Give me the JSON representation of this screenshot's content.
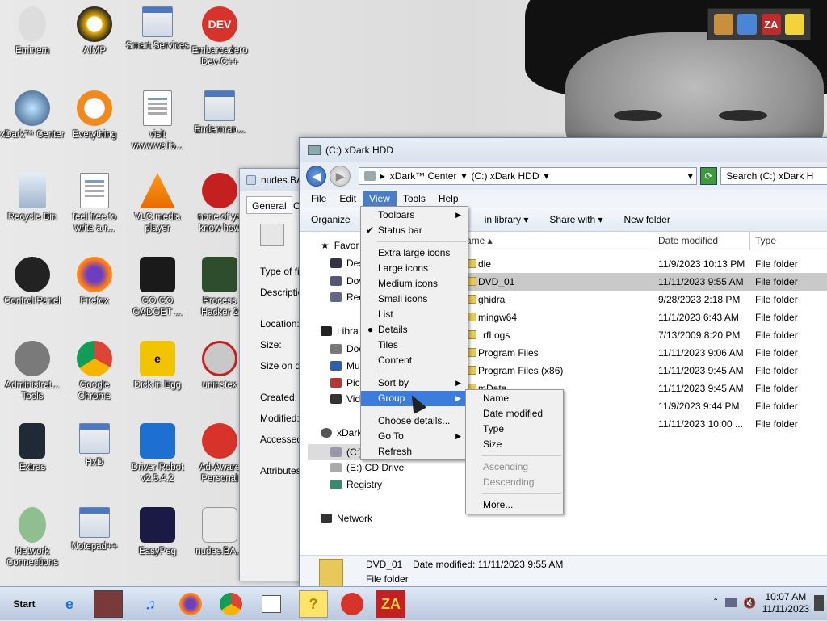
{
  "desktop": {
    "icons": [
      {
        "label": "Eminem"
      },
      {
        "label": "AIMP"
      },
      {
        "label": "Smart Services"
      },
      {
        "label": "Embarcadero Dev-C++"
      },
      {
        "label": "xDark™ Center"
      },
      {
        "label": "Everything"
      },
      {
        "label": "visit www.walib..."
      },
      {
        "label": "Enderman..."
      },
      {
        "label": "Recycle Bin"
      },
      {
        "label": "feel free to write a r..."
      },
      {
        "label": "VLC media player"
      },
      {
        "label": "none of yo know how"
      },
      {
        "label": "Control Panel"
      },
      {
        "label": "Firefox"
      },
      {
        "label": "GO GO GADGET ..."
      },
      {
        "label": "Process Hacker 2"
      },
      {
        "label": "Administrat... Tools"
      },
      {
        "label": "Google Chrome"
      },
      {
        "label": "Dick in Egg"
      },
      {
        "label": "uninstex"
      },
      {
        "label": "Extras"
      },
      {
        "label": "HxD"
      },
      {
        "label": "Driver Robot v2.5.4.2"
      },
      {
        "label": "Ad-Aware Personal"
      },
      {
        "label": "Network Connections"
      },
      {
        "label": "Notepad++"
      },
      {
        "label": "EasyPeg"
      },
      {
        "label": "nudes.BA..."
      }
    ],
    "toolbar_badge": "ZA"
  },
  "properties": {
    "title": "nudes.BA",
    "tab_general": "General",
    "tab_other": "C",
    "labels": [
      "Type of fil",
      "Descriptio",
      "Location:",
      "Size:",
      "Size on di",
      "Created:",
      "Modified:",
      "Accessed",
      "Attributes:"
    ]
  },
  "explorer": {
    "title": "(C:) xDark HDD",
    "breadcrumb": [
      "xDark™ Center",
      "(C:) xDark HDD"
    ],
    "search_placeholder": "Search (C:) xDark H",
    "menu": [
      "File",
      "Edit",
      "View",
      "Tools",
      "Help"
    ],
    "commands": {
      "organize": "Organize",
      "include": "in library",
      "share": "Share with",
      "newfolder": "New folder"
    },
    "nav": {
      "favorites": "Favor",
      "desktop": "Des",
      "downloads": "Dov",
      "recent": "Rec",
      "libraries": "Libra",
      "documents": "Doc",
      "music": "Mu",
      "pictures": "Pict",
      "videos": "Vide",
      "computer": "xDark",
      "cdrive": "(C:)",
      "edrive": "(E:) CD Drive",
      "registry": "Registry",
      "network": "Network"
    },
    "columns": {
      "name": "ame",
      "date": "Date modified",
      "type": "Type"
    },
    "files": [
      {
        "name": "die",
        "date": "11/9/2023 10:13 PM",
        "type": "File folder"
      },
      {
        "name": "DVD_01",
        "date": "11/11/2023 9:55 AM",
        "type": "File folder"
      },
      {
        "name": "ghidra",
        "date": "9/28/2023 2:18 PM",
        "type": "File folder"
      },
      {
        "name": "mingw64",
        "date": "11/1/2023 6:43 AM",
        "type": "File folder"
      },
      {
        "name": "rfLogs",
        "date": "7/13/2009 8:20 PM",
        "type": "File folder"
      },
      {
        "name": "Program Files",
        "date": "11/11/2023 9:06 AM",
        "type": "File folder"
      },
      {
        "name": "Program Files (x86)",
        "date": "11/11/2023 9:45 AM",
        "type": "File folder"
      },
      {
        "name": "mData",
        "date": "11/11/2023 9:45 AM",
        "type": "File folder"
      },
      {
        "name": "",
        "date": "11/9/2023 9:44 PM",
        "type": "File folder"
      },
      {
        "name": "",
        "date": "11/11/2023 10:00 ...",
        "type": "File folder"
      }
    ],
    "details": {
      "name": "DVD_01",
      "modified": "Date modified: 11/11/2023 9:55 AM",
      "kind": "File folder"
    }
  },
  "view_menu": {
    "items": [
      "Toolbars",
      "Status bar",
      "Extra large icons",
      "Large icons",
      "Medium icons",
      "Small icons",
      "List",
      "Details",
      "Tiles",
      "Content",
      "Sort by",
      "Group by",
      "Choose details...",
      "Go To",
      "Refresh"
    ],
    "group_label": "Group"
  },
  "group_menu": {
    "items": [
      "Name",
      "Date modified",
      "Type",
      "Size",
      "Ascending",
      "Descending",
      "More..."
    ]
  },
  "taskbar": {
    "start": "Start",
    "za": "ZA",
    "time": "10:07 AM",
    "date": "11/11/2023"
  }
}
